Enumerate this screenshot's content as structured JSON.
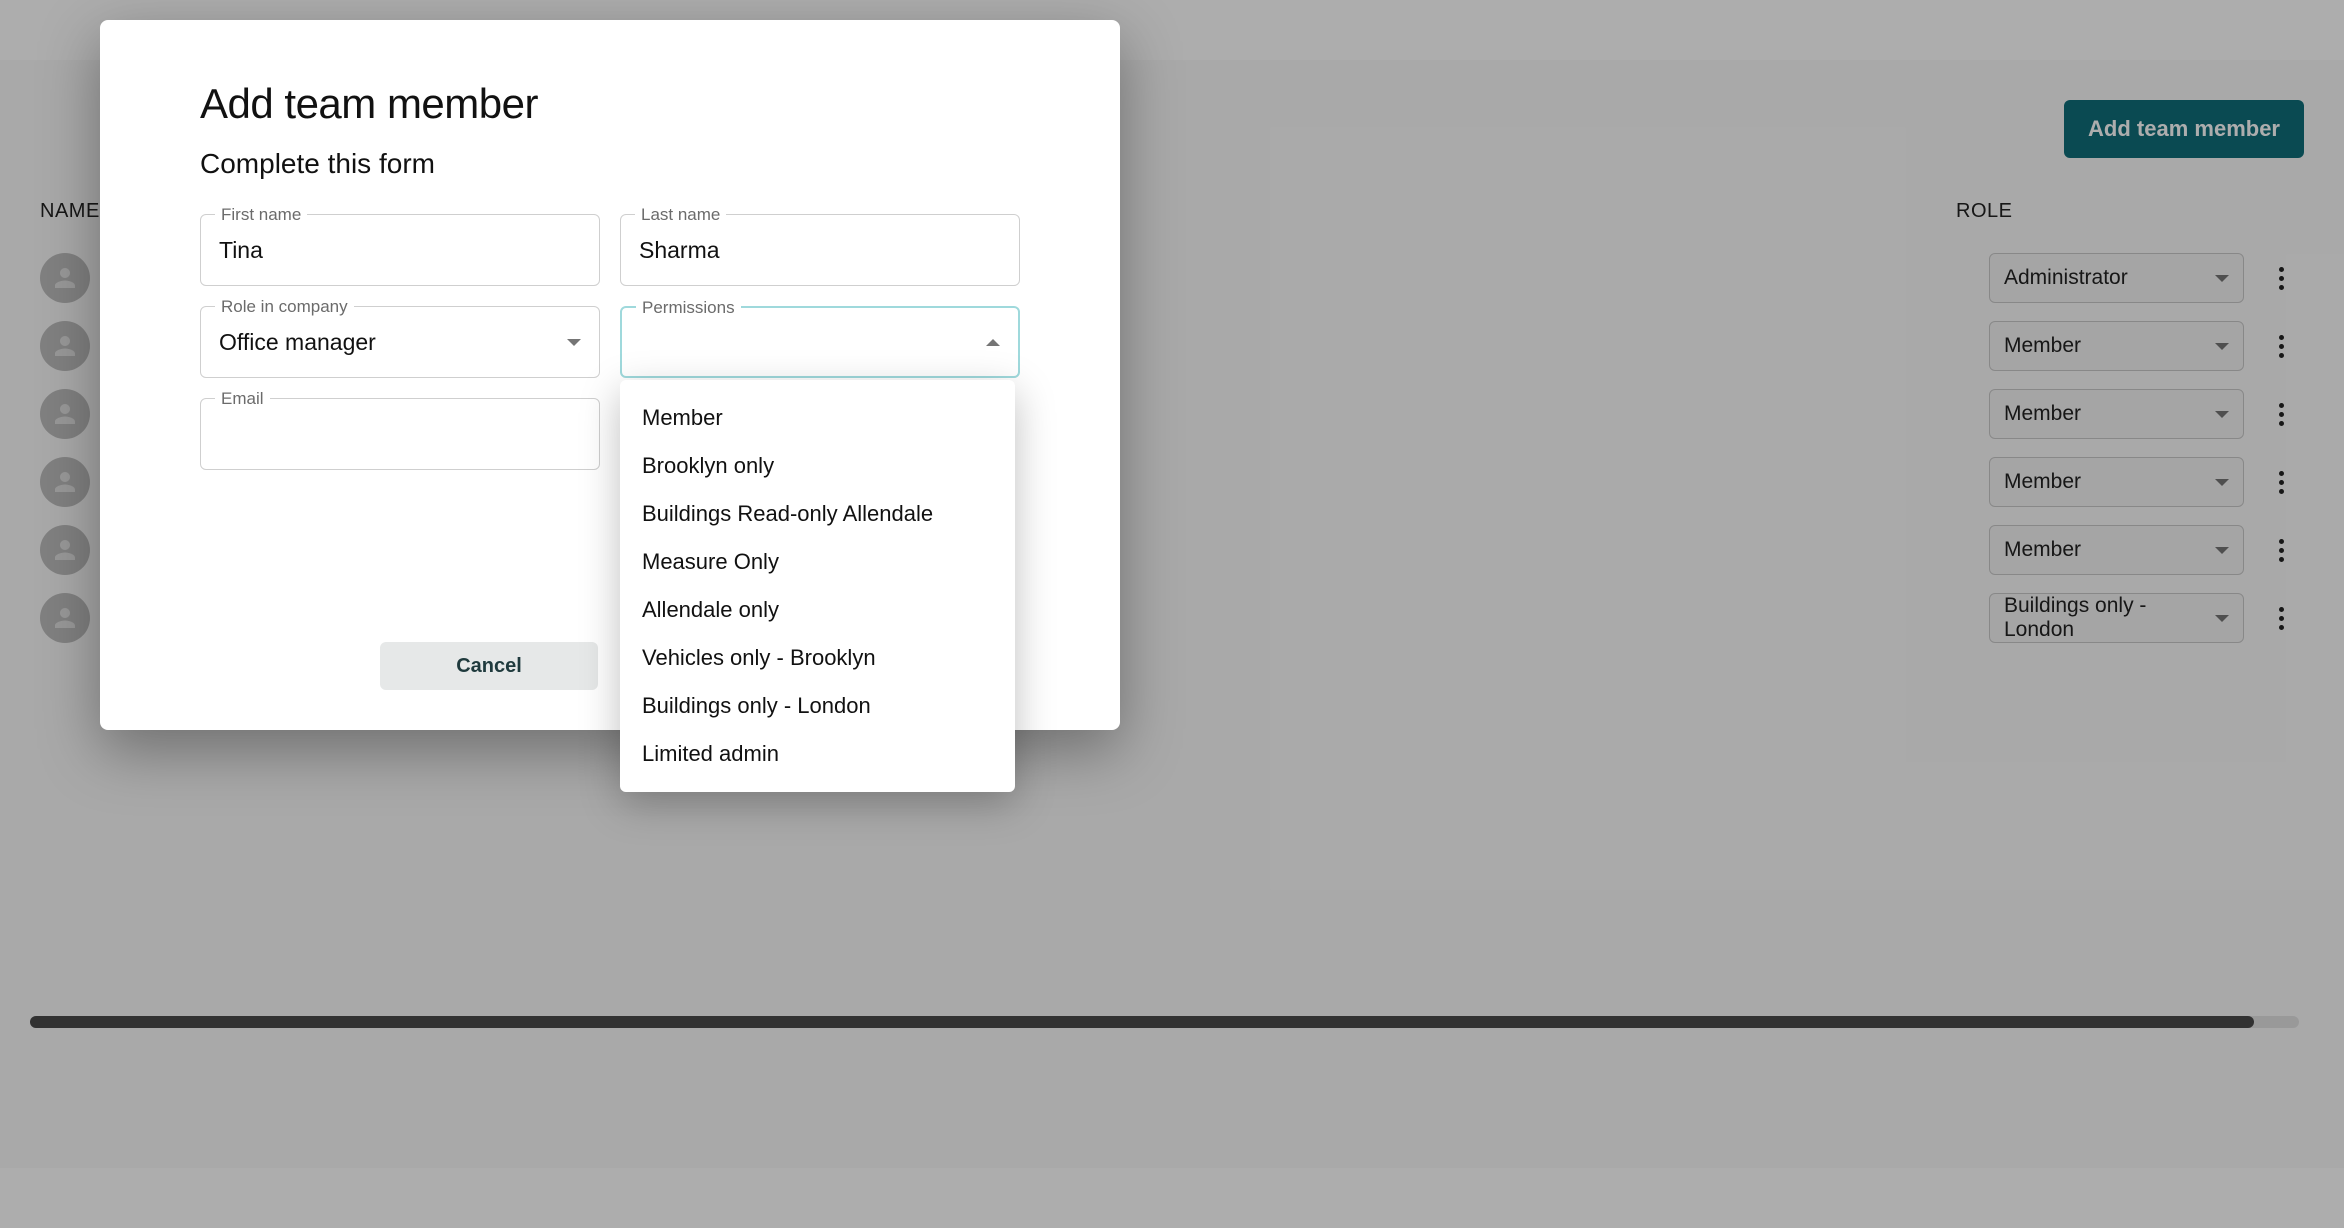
{
  "background": {
    "add_button_label": "Add team member",
    "columns": {
      "name": "NAME",
      "role": "ROLE"
    },
    "rows": [
      {
        "role": "Administrator"
      },
      {
        "role": "Member"
      },
      {
        "role": "Member"
      },
      {
        "role": "Member"
      },
      {
        "role": "Member"
      },
      {
        "role": "Buildings only - London"
      }
    ]
  },
  "modal": {
    "title": "Add team member",
    "subtitle": "Complete this form",
    "fields": {
      "first_name": {
        "label": "First name",
        "value": "Tina"
      },
      "last_name": {
        "label": "Last name",
        "value": "Sharma"
      },
      "role": {
        "label": "Role in company",
        "value": "Office manager"
      },
      "permissions": {
        "label": "Permissions",
        "value": ""
      },
      "email": {
        "label": "Email",
        "value": ""
      }
    },
    "cancel_label": "Cancel"
  },
  "permissions_options": [
    "Member",
    "Brooklyn only",
    "Buildings Read-only Allendale",
    "Measure Only",
    "Allendale only",
    "Vehicles only - Brooklyn",
    "Buildings only - London",
    "Limited admin"
  ]
}
